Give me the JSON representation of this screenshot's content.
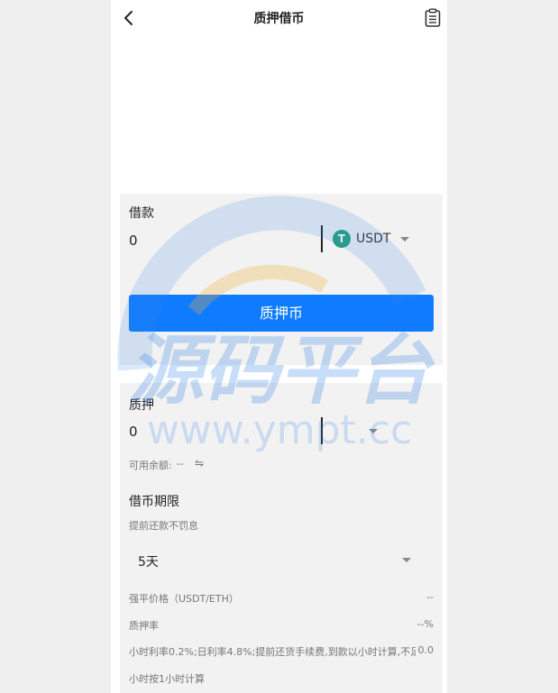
{
  "nav": {
    "title": "质押借币",
    "back_icon": "chevron-left-icon",
    "record_icon": "document-list-icon"
  },
  "borrow": {
    "label": "借款",
    "amount": "0",
    "coin": "USDT",
    "coin_symbol": "T",
    "coin_color": "#27a17a"
  },
  "pledge_button": {
    "label": "质押币"
  },
  "collateral": {
    "label": "质押",
    "amount": "0",
    "available_label": "可用余额:",
    "available_value": "--",
    "swap_icon": "⇋"
  },
  "term": {
    "label": "借币期限",
    "hint": "提前还款不罚息",
    "value": "5天"
  },
  "rows": {
    "liquidation_label": "强平价格（USDT/ETH）",
    "liquidation_value": "--",
    "ratio_label": "质押率",
    "ratio_value": "--%",
    "rate_text": "小时利率0.2%;日利率4.8%;提前还货手续费,到款以小时计算,不足1",
    "rate_value": "0.0",
    "rate_text2": "小时按1小时计算"
  },
  "watermark": {
    "title": "源码平台",
    "url": "www.ympt.cc"
  },
  "colors": {
    "accent": "#0f7cff",
    "card": "#f2f2f2",
    "usdt": "#27a17a"
  }
}
